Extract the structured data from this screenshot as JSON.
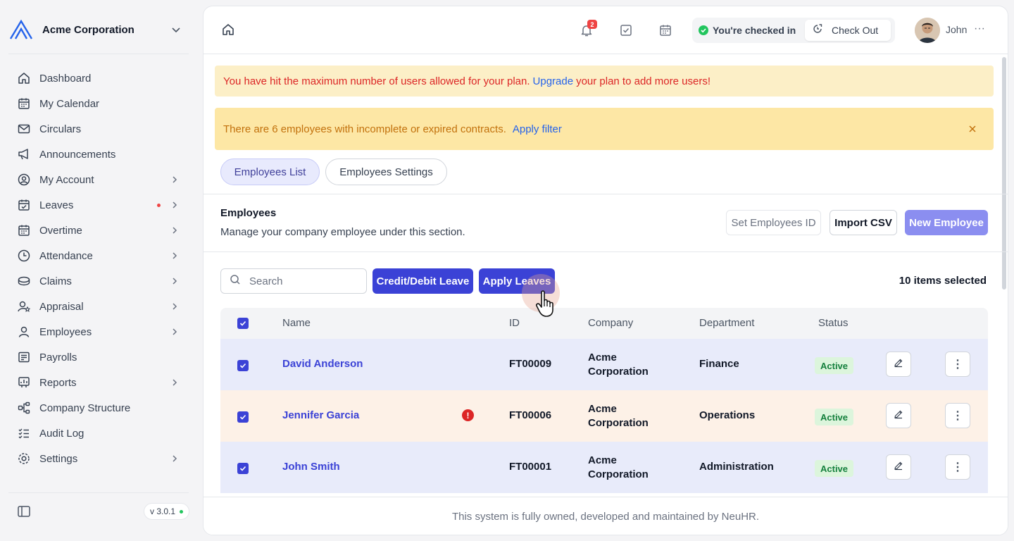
{
  "sidebar": {
    "company": "Acme Corporation",
    "items": [
      {
        "label": "Dashboard",
        "icon": "home-icon"
      },
      {
        "label": "My Calendar",
        "icon": "calendar-icon"
      },
      {
        "label": "Circulars",
        "icon": "mail-icon"
      },
      {
        "label": "Announcements",
        "icon": "megaphone-icon"
      },
      {
        "label": "My Account",
        "icon": "user-circle-icon"
      },
      {
        "label": "Leaves",
        "icon": "calendar-check-icon"
      },
      {
        "label": "Overtime",
        "icon": "calendar-clock-icon"
      },
      {
        "label": "Attendance",
        "icon": "clock-icon"
      },
      {
        "label": "Claims",
        "icon": "coins-icon"
      },
      {
        "label": "Appraisal",
        "icon": "user-star-icon"
      },
      {
        "label": "Employees",
        "icon": "user-icon"
      },
      {
        "label": "Payrolls",
        "icon": "receipt-icon"
      },
      {
        "label": "Reports",
        "icon": "report-icon"
      },
      {
        "label": "Company Structure",
        "icon": "hierarchy-icon"
      },
      {
        "label": "Audit Log",
        "icon": "checklist-icon"
      },
      {
        "label": "Settings",
        "icon": "gear-icon"
      }
    ],
    "version": "v 3.0.1"
  },
  "topbar": {
    "notification_count": "2",
    "checkin_status": "You're checked in",
    "checkout_label": "Check Out",
    "user_name": "John"
  },
  "alerts": {
    "limit_prefix": "You have hit the maximum number of users allowed for your plan.",
    "limit_link": "Upgrade",
    "limit_suffix": "your plan to add more users!",
    "contract_text": "There are 6 employees with incomplete or expired contracts.",
    "contract_link": "Apply filter"
  },
  "tabs": [
    {
      "label": "Employees List",
      "active": true
    },
    {
      "label": "Employees Settings",
      "active": false
    }
  ],
  "section": {
    "title": "Employees",
    "description": "Manage your company employee under this section.",
    "set_id_label": "Set Employees ID",
    "import_label": "Import CSV",
    "new_label": "New Employee"
  },
  "toolbar": {
    "search_placeholder": "Search",
    "credit_label": "Credit/Debit Leave",
    "apply_label": "Apply Leaves",
    "selected_text": "10 items selected"
  },
  "table": {
    "headers": [
      "Name",
      "ID",
      "Company",
      "Department",
      "Status"
    ],
    "rows": [
      {
        "name": "David Anderson",
        "id": "FT00009",
        "company": "Acme Corporation",
        "department": "Finance",
        "status": "Active",
        "warning": false
      },
      {
        "name": "Jennifer Garcia",
        "id": "FT00006",
        "company": "Acme Corporation",
        "department": "Operations",
        "status": "Active",
        "warning": true
      },
      {
        "name": "John Smith",
        "id": "FT00001",
        "company": "Acme Corporation",
        "department": "Administration",
        "status": "Active",
        "warning": false
      }
    ]
  },
  "footer": "This system is fully owned, developed and maintained by NeuHR.",
  "colors": {
    "primary": "#3b42d6",
    "new_employee": "#8b8ef0",
    "alert_red": "#dc2626",
    "alert_orange": "#c2710c",
    "status_green": "#15803d"
  }
}
